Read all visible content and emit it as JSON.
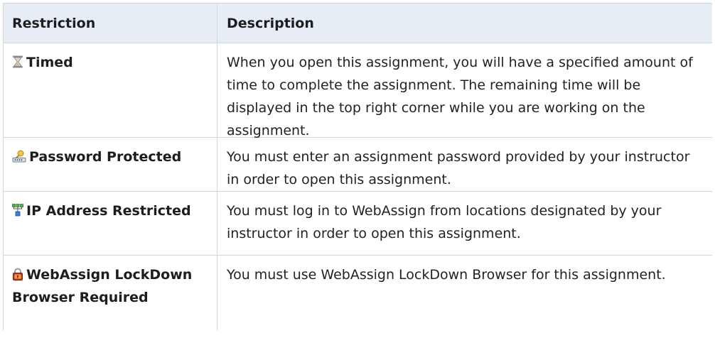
{
  "table": {
    "headers": {
      "restriction": "Restriction",
      "description": "Description"
    },
    "rows": [
      {
        "icon": "hourglass-icon",
        "restriction": "Timed",
        "description": "When you open this assignment, you will have a specified amount of time to complete the assignment. The remaining time will be displayed in the top right corner while you are working on the assignment."
      },
      {
        "icon": "password-key-icon",
        "restriction": "Password Protected",
        "description": "You must enter an assignment password provided by your instructor in order to open this assignment."
      },
      {
        "icon": "network-icon",
        "restriction": "IP Address Restricted",
        "description": "You must log in to WebAssign from locations designated by your instructor in order to open this assignment."
      },
      {
        "icon": "lock-icon",
        "restriction": "WebAssign LockDown Browser Required",
        "description": "You must use WebAssign LockDown Browser for this assignment."
      }
    ]
  },
  "colors": {
    "header_bg": "#e6edf4",
    "border": "#cfd8e0"
  }
}
